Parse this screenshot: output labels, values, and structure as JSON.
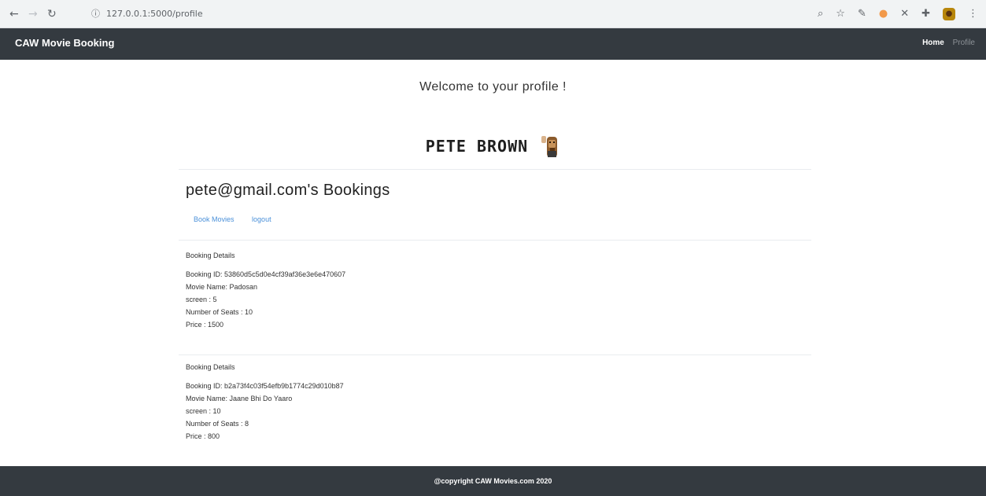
{
  "browser": {
    "url": "127.0.0.1:5000/profile",
    "icons": [
      "back-icon",
      "forward-icon",
      "reload-icon",
      "info-icon",
      "zoom-icon",
      "star-icon",
      "extension-icon",
      "extension-icon",
      "close-icon",
      "puzzle-icon",
      "profile-avatar-icon",
      "menu-icon"
    ]
  },
  "navbar": {
    "brand": "CAW Movie Booking",
    "links": [
      {
        "label": "Home",
        "active": true
      },
      {
        "label": "Profile",
        "active": false
      }
    ]
  },
  "welcome": "Welcome to your profile !",
  "user": {
    "name": "PETE BROWN",
    "email": "pete@gmail.com"
  },
  "bookings_title": "pete@gmail.com's Bookings",
  "tabs": [
    {
      "label": "Book Movies"
    },
    {
      "label": "logout"
    }
  ],
  "bookings": [
    {
      "heading": "Booking Details",
      "id_line": "Booking ID: 53860d5c5d0e4cf39af36e3e6e470607",
      "movie_line": "Movie Name: Padosan",
      "screen_line": "screen : 5",
      "seats_line": "Number of Seats : 10",
      "price_line": "Price : 1500"
    },
    {
      "heading": "Booking Details",
      "id_line": "Booking ID: b2a73f4c03f54efb9b1774c29d010b87",
      "movie_line": "Movie Name: Jaane Bhi Do Yaaro",
      "screen_line": "screen : 10",
      "seats_line": "Number of Seats : 8",
      "price_line": "Price : 800"
    }
  ],
  "footer": "@copyright CAW Movies.com 2020",
  "colors": {
    "navbar_bg": "#343a40",
    "link_blue": "#4a90d9",
    "page_bg": "#ffffff"
  }
}
